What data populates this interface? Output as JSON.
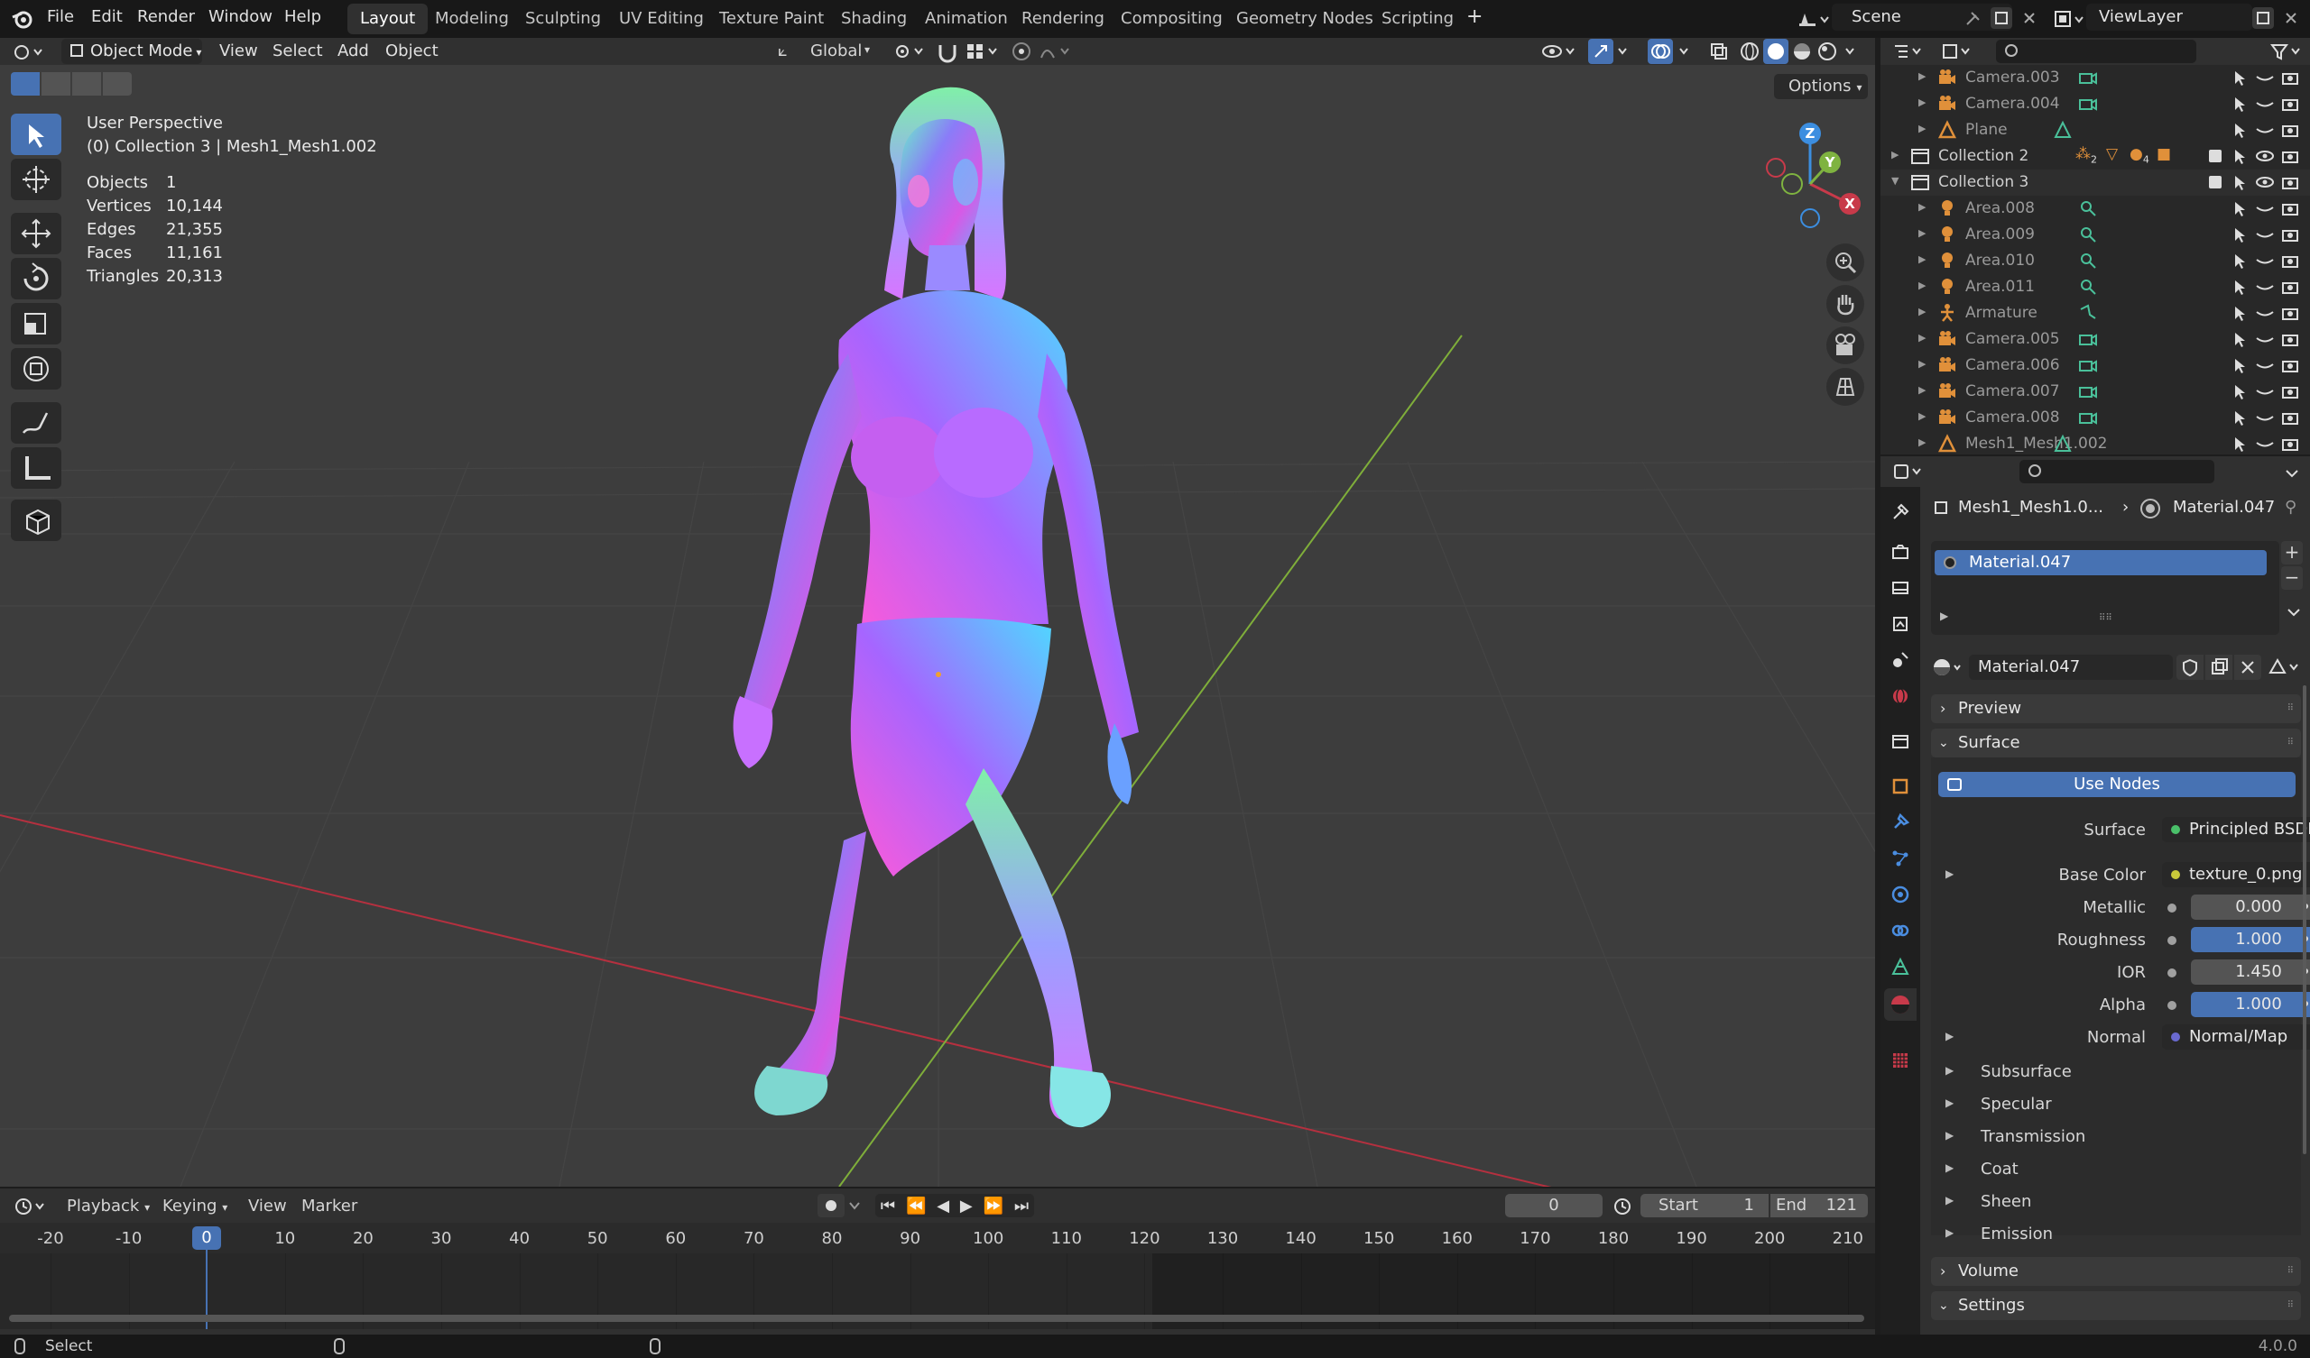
{
  "topbar": {
    "menus": [
      "File",
      "Edit",
      "Render",
      "Window",
      "Help"
    ],
    "workspaces": [
      "Layout",
      "Modeling",
      "Sculpting",
      "UV Editing",
      "Texture Paint",
      "Shading",
      "Animation",
      "Rendering",
      "Compositing",
      "Geometry Nodes",
      "Scripting"
    ],
    "active_workspace": "Layout",
    "add_tab": "+",
    "scene": "Scene",
    "view_layer": "ViewLayer"
  },
  "viewport_header": {
    "mode": "Object Mode",
    "menus": [
      "View",
      "Select",
      "Add",
      "Object"
    ],
    "orientation": "Global",
    "options": "Options"
  },
  "viewport": {
    "view_name": "User Perspective",
    "collection_info": "(0) Collection 3 | Mesh1_Mesh1.002",
    "stats": [
      {
        "label": "Objects",
        "value": "1"
      },
      {
        "label": "Vertices",
        "value": "10,144"
      },
      {
        "label": "Edges",
        "value": "21,355"
      },
      {
        "label": "Faces",
        "value": "11,161"
      },
      {
        "label": "Triangles",
        "value": "20,313"
      }
    ],
    "gizmo": {
      "x": "X",
      "y": "Y",
      "z": "Z"
    }
  },
  "outliner": {
    "rows": [
      {
        "name": "Camera.003",
        "type": "camera",
        "dim": true
      },
      {
        "name": "Camera.004",
        "type": "camera",
        "dim": true
      },
      {
        "name": "Plane",
        "type": "mesh",
        "dim": true
      },
      {
        "name": "Collection 2",
        "type": "collection",
        "dim": false
      },
      {
        "name": "Collection 3",
        "type": "collection",
        "dim": false
      },
      {
        "name": "Area.008",
        "type": "light",
        "dim": true
      },
      {
        "name": "Area.009",
        "type": "light",
        "dim": true
      },
      {
        "name": "Area.010",
        "type": "light",
        "dim": true
      },
      {
        "name": "Area.011",
        "type": "light",
        "dim": true
      },
      {
        "name": "Armature",
        "type": "armature",
        "dim": true
      },
      {
        "name": "Camera.005",
        "type": "camera",
        "dim": true
      },
      {
        "name": "Camera.006",
        "type": "camera",
        "dim": true
      },
      {
        "name": "Camera.007",
        "type": "camera",
        "dim": true
      },
      {
        "name": "Camera.008",
        "type": "camera",
        "dim": true
      },
      {
        "name": "Mesh1_Mesh1.002",
        "type": "mesh",
        "dim": true
      }
    ],
    "collection2_badges": [
      "2",
      "4"
    ]
  },
  "properties": {
    "breadcrumb_object": "Mesh1_Mesh1.0...",
    "breadcrumb_material": "Material.047",
    "slot_material": "Material.047",
    "material_name": "Material.047",
    "panels": {
      "preview": "Preview",
      "surface": "Surface",
      "volume": "Volume",
      "settings": "Settings"
    },
    "use_nodes": "Use Nodes",
    "surface_label": "Surface",
    "surface_value": "Principled BSDF",
    "base_color_label": "Base Color",
    "base_color_value": "texture_0.png",
    "metallic_label": "Metallic",
    "metallic_value": "0.000",
    "roughness_label": "Roughness",
    "roughness_value": "1.000",
    "ior_label": "IOR",
    "ior_value": "1.450",
    "alpha_label": "Alpha",
    "alpha_value": "1.000",
    "normal_label": "Normal",
    "normal_value": "Normal/Map",
    "subpanels": [
      "Subsurface",
      "Specular",
      "Transmission",
      "Coat",
      "Sheen",
      "Emission"
    ]
  },
  "timeline": {
    "menus": [
      "Playback",
      "Keying",
      "View",
      "Marker"
    ],
    "current_frame": "0",
    "start_label": "Start",
    "start_value": "1",
    "end_label": "End",
    "end_value": "121",
    "ruler": [
      "-20",
      "-10",
      "0",
      "10",
      "20",
      "30",
      "40",
      "50",
      "60",
      "70",
      "80",
      "90",
      "100",
      "110",
      "120",
      "130",
      "140",
      "150",
      "160",
      "170",
      "180",
      "190",
      "200",
      "210"
    ]
  },
  "statusbar": {
    "left": "Select",
    "version": "4.0.0"
  },
  "colors": {
    "accent": "#4772b3",
    "x_axis": "#c83a4a",
    "y_axis": "#7fb340",
    "z_axis": "#3c8ee0",
    "object_orange": "#e0903a",
    "data_green": "#4ac09a"
  }
}
